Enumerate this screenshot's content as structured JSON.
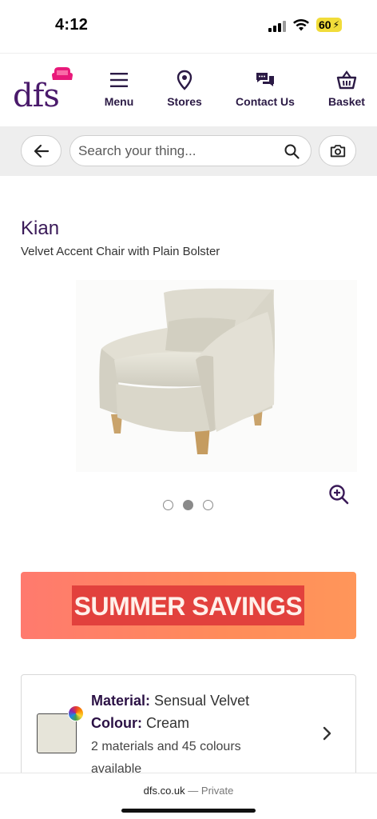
{
  "status_bar": {
    "time": "4:12",
    "battery": "60"
  },
  "header": {
    "logo_text": "dfs",
    "nav": [
      {
        "label": "Menu",
        "icon": "menu-icon"
      },
      {
        "label": "Stores",
        "icon": "location-pin-icon"
      },
      {
        "label": "Contact Us",
        "icon": "chat-icon"
      },
      {
        "label": "Basket",
        "icon": "basket-icon"
      }
    ]
  },
  "search": {
    "placeholder": "Search your thing..."
  },
  "product": {
    "name": "Kian",
    "subtitle": "Velvet Accent Chair with Plain Bolster",
    "gallery_dots": 3,
    "gallery_active": 2
  },
  "banner": {
    "text": "SUMMER SAVINGS"
  },
  "material": {
    "material_label": "Material:",
    "material_value": "Sensual Velvet",
    "colour_label": "Colour:",
    "colour_value": "Cream",
    "availability": "2 materials and 45 colours available",
    "swatch_color": "#e6e4d9"
  },
  "browser": {
    "domain": "dfs.co.uk",
    "mode": "— Private"
  },
  "colors": {
    "brand_purple": "#4a1a6b",
    "banner_orange": "#ff8b5a",
    "banner_red": "#e2413d"
  }
}
